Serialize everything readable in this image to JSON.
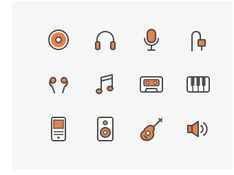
{
  "colors": {
    "background": "#f6f6f7",
    "outline": "#4a4a52",
    "accent": "#e8824a"
  },
  "icons": [
    {
      "name": "vinyl-record-icon"
    },
    {
      "name": "headphones-icon"
    },
    {
      "name": "microphone-icon"
    },
    {
      "name": "audio-jack-cable-icon"
    },
    {
      "name": "earphones-icon"
    },
    {
      "name": "music-note-icon"
    },
    {
      "name": "cassette-tape-icon"
    },
    {
      "name": "piano-keyboard-icon"
    },
    {
      "name": "portable-music-player-icon"
    },
    {
      "name": "speaker-icon"
    },
    {
      "name": "acoustic-guitar-icon"
    },
    {
      "name": "volume-speaker-icon"
    }
  ]
}
